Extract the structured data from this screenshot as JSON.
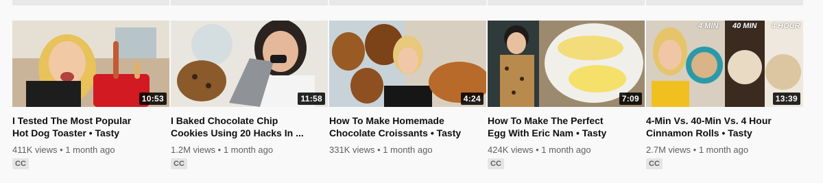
{
  "videos": [
    {
      "title_line1": "I Tested The Most Popular",
      "title_line2": "Hot Dog Toaster • Tasty",
      "views": "411K views",
      "age": "1 month ago",
      "duration": "10:53",
      "badge": "CC"
    },
    {
      "title_line1": "I Baked Chocolate Chip",
      "title_line2": "Cookies Using 20 Hacks In ...",
      "views": "1.2M views",
      "age": "1 month ago",
      "duration": "11:58",
      "badge": "CC"
    },
    {
      "title_line1": "How To Make Homemade",
      "title_line2": "Chocolate Croissants • Tasty",
      "views": "331K views",
      "age": "1 month ago",
      "duration": "4:24",
      "badge": null
    },
    {
      "title_line1": "How To Make The Perfect",
      "title_line2": "Egg With Eric Nam • Tasty",
      "views": "424K views",
      "age": "1 month ago",
      "duration": "7:09",
      "badge": "CC"
    },
    {
      "title_line1": "4-Min Vs. 40-Min Vs. 4 Hour",
      "title_line2": "Cinnamon Rolls • Tasty",
      "views": "2.7M views",
      "age": "1 month ago",
      "duration": "13:39",
      "badge": "CC",
      "thumb_labels": [
        "4 MIN",
        "40 MIN",
        "4 HOUR"
      ]
    }
  ],
  "separator": "•"
}
